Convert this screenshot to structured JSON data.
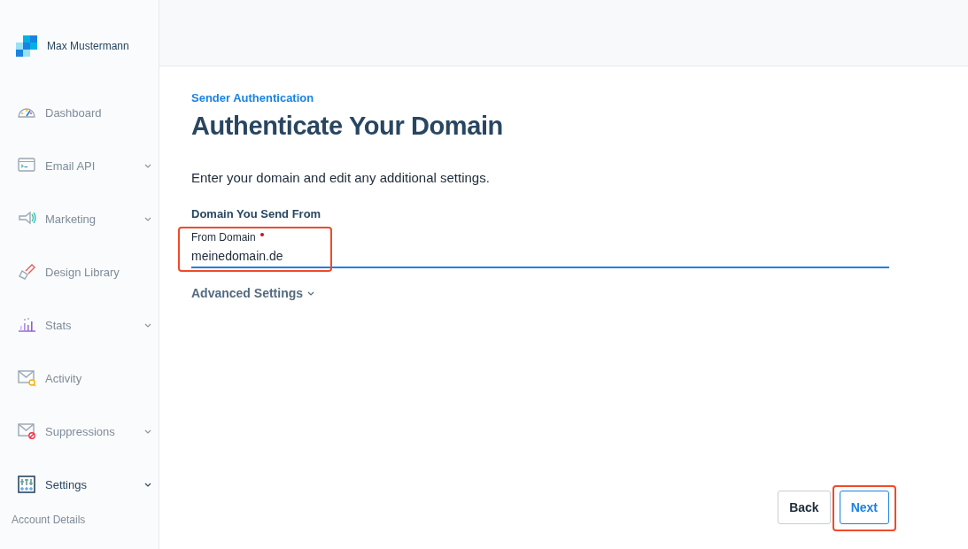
{
  "sidebar": {
    "account_name": "Max Mustermann",
    "items": [
      {
        "label": "Dashboard",
        "expandable": false,
        "selected": false
      },
      {
        "label": "Email API",
        "expandable": true,
        "selected": false
      },
      {
        "label": "Marketing",
        "expandable": true,
        "selected": false
      },
      {
        "label": "Design Library",
        "expandable": false,
        "selected": false
      },
      {
        "label": "Stats",
        "expandable": true,
        "selected": false
      },
      {
        "label": "Activity",
        "expandable": false,
        "selected": false
      },
      {
        "label": "Suppressions",
        "expandable": true,
        "selected": false
      },
      {
        "label": "Settings",
        "expandable": true,
        "selected": true,
        "children": [
          {
            "label": "Account Details",
            "selected": false
          }
        ]
      }
    ]
  },
  "page": {
    "eyebrow": "Sender Authentication",
    "title": "Authenticate Your Domain",
    "intro": "Enter your domain and edit any additional settings.",
    "section_title": "Domain You Send From",
    "field": {
      "label": "From Domain",
      "required": true,
      "value": "meinedomain.de",
      "highlighted": true
    },
    "advanced_toggle": {
      "label": "Advanced Settings",
      "expanded": false
    }
  },
  "buttons": [
    {
      "label": "Back",
      "kind": "secondary",
      "highlighted": false
    },
    {
      "label": "Next",
      "kind": "primary",
      "highlighted": true
    }
  ]
}
